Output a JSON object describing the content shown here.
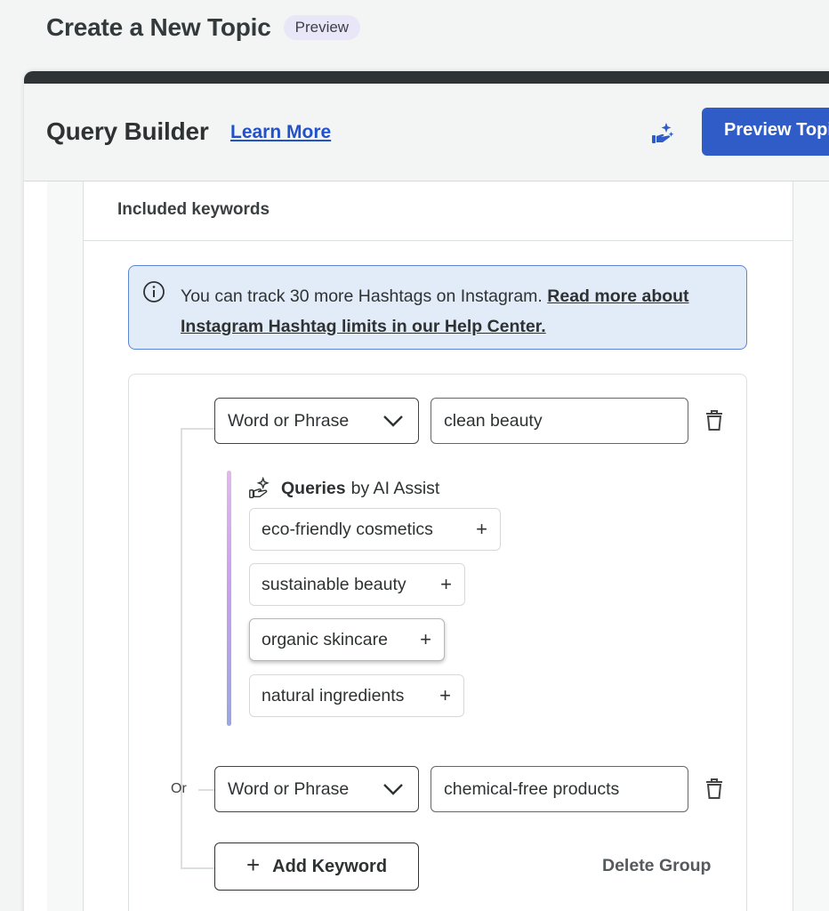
{
  "page": {
    "title": "Create a New Topic",
    "badge": "Preview"
  },
  "query_builder": {
    "title": "Query Builder",
    "learn_more": "Learn More",
    "ai_button_icon": "ai-sparkle-hand-icon",
    "preview_button": "Preview Topic"
  },
  "included_keywords": {
    "header": "Included keywords",
    "info": {
      "text": "You can track 30 more Hashtags on Instagram. ",
      "link": "Read more about Instagram Hashtag limits in our Help Center."
    },
    "group": {
      "rows": [
        {
          "type": "Word or Phrase",
          "value": "clean beauty"
        },
        {
          "connector": "Or",
          "type": "Word or Phrase",
          "value": "chemical-free products"
        }
      ],
      "ai_assist": {
        "title_bold": "Queries",
        "title_rest": "by AI Assist",
        "suggestions": [
          "eco-friendly cosmetics",
          "sustainable beauty",
          "organic skincare",
          "natural ingredients"
        ]
      },
      "add_keyword": "Add Keyword",
      "delete_group": "Delete Group"
    }
  },
  "colors": {
    "accent": "#2f5cc7",
    "link": "#2252c9",
    "info_bg": "#e2ebf8",
    "info_border": "#5b86d4",
    "panel_top": "#2e3436"
  }
}
